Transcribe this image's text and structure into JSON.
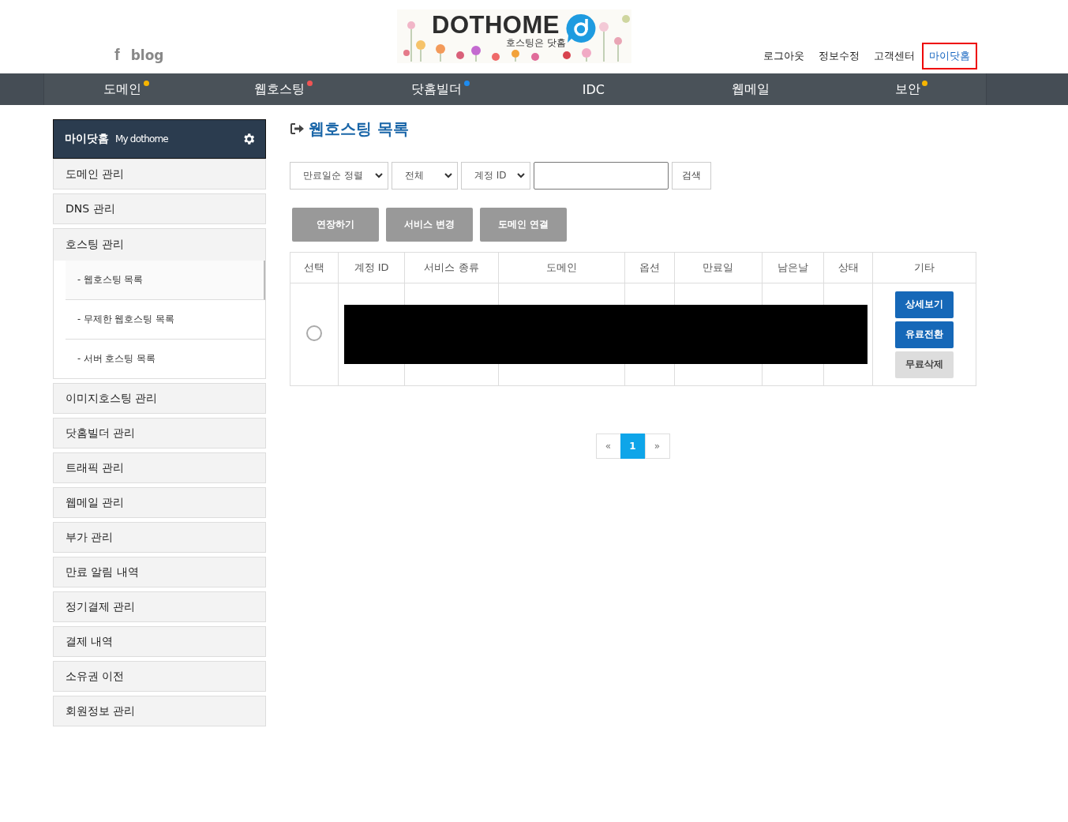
{
  "header": {
    "social_links": [
      "f",
      "blog"
    ],
    "logo": {
      "name": "DOTHOME",
      "tagline": "호스팅은 닷홈"
    },
    "top_links": [
      {
        "label": "로그아웃",
        "selected": false
      },
      {
        "label": "정보수정",
        "selected": false
      },
      {
        "label": "고객센터",
        "selected": false
      },
      {
        "label": "마이닷홈",
        "selected": true
      }
    ]
  },
  "nav": [
    {
      "label": "도메인",
      "color": "#f7b500"
    },
    {
      "label": "웹호스팅",
      "color": "#f05454"
    },
    {
      "label": "닷홈빌더",
      "color": "#1e8cf0"
    },
    {
      "label": "IDC"
    },
    {
      "label": "웹메일"
    },
    {
      "label": "보안",
      "color": "#f7b500"
    }
  ],
  "sidebar": {
    "title": "마이닷홈",
    "subtitle": "My dothome",
    "items": [
      {
        "label": "도메인 관리"
      },
      {
        "label": "DNS 관리"
      },
      {
        "label": "호스팅 관리",
        "children": [
          {
            "label": "- 웹호스팅 목록",
            "selected": true
          },
          {
            "label": "- 무제한 웹호스팅 목록",
            "selected": false
          },
          {
            "label": "- 서버 호스팅 목록",
            "selected": false
          }
        ]
      },
      {
        "label": "이미지호스팅 관리"
      },
      {
        "label": "닷홈빌더 관리"
      },
      {
        "label": "트래픽 관리"
      },
      {
        "label": "웹메일 관리"
      },
      {
        "label": "부가 관리"
      },
      {
        "label": "만료 알림 내역"
      },
      {
        "label": "정기결제 관리"
      },
      {
        "label": "결제 내역"
      },
      {
        "label": "소유권 이전"
      },
      {
        "label": "회원정보 관리"
      }
    ]
  },
  "main": {
    "title": "웹호스팅 목록",
    "filters": {
      "sort": "만료일순 정렬",
      "status": "전체",
      "field": "계정 ID",
      "search_button": "검색"
    },
    "actions": [
      "연장하기",
      "서비스 변경",
      "도메인 연결"
    ],
    "table": {
      "columns": [
        "선택",
        "계정 ID",
        "서비스 종류",
        "도메인",
        "옵션",
        "만료일",
        "남은날",
        "상태",
        "기타"
      ],
      "rows": [
        {
          "selected": false,
          "buttons": [
            {
              "label": "상세보기",
              "kind": "primary"
            },
            {
              "label": "유료전환",
              "kind": "primary"
            },
            {
              "label": "무료삭제",
              "kind": "secondary"
            }
          ]
        }
      ]
    },
    "pagination": [
      {
        "label": "«",
        "selected": false
      },
      {
        "label": "1",
        "selected": true
      },
      {
        "label": "»",
        "selected": false
      }
    ]
  }
}
